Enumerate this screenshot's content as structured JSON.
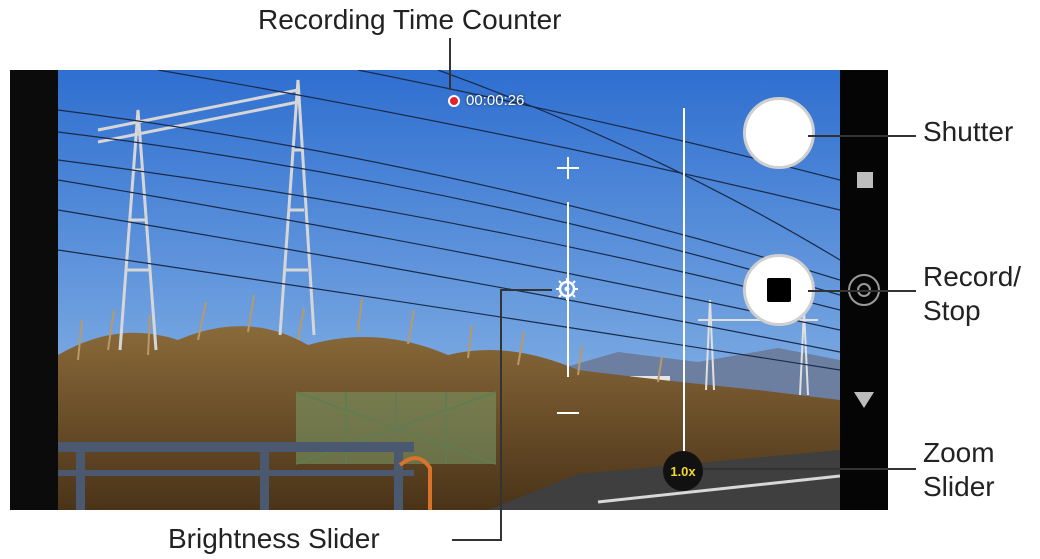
{
  "callouts": {
    "recording_time_counter": "Recording Time Counter",
    "shutter": "Shutter",
    "record_stop_line1": "Record/",
    "record_stop_line2": "Stop",
    "zoom_line1": "Zoom",
    "zoom_line2": "Slider",
    "brightness_slider": "Brightness Slider"
  },
  "camera": {
    "recording_time": "00:00:26",
    "zoom_level": "1.0x"
  },
  "sidebar": {
    "icons": [
      "photo-mode-icon",
      "switch-camera-icon",
      "collapse-menu-icon"
    ]
  },
  "colors": {
    "record_dot": "#e8202a",
    "zoom_text": "#f3d82a",
    "sky_top": "#2f6fd0",
    "sky_bottom": "#9cc3ea"
  }
}
